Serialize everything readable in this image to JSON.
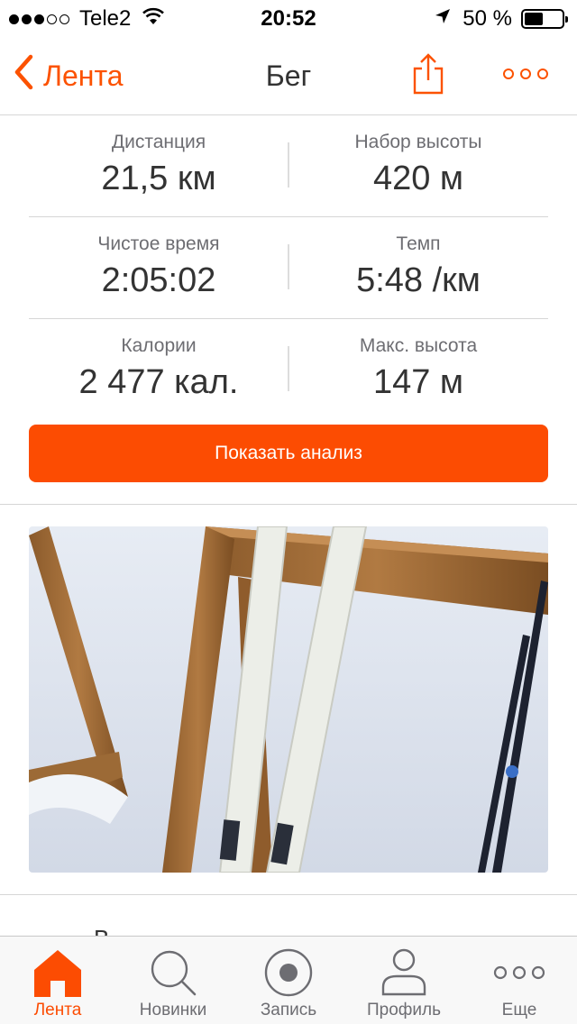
{
  "status_bar": {
    "carrier": "Tele2",
    "time": "20:52",
    "battery": "50 %",
    "signal_bars_filled": 3,
    "signal_bars_total": 5,
    "battery_level": 0.5
  },
  "nav": {
    "back_label": "Лента",
    "title": "Бег"
  },
  "stats": [
    {
      "left": {
        "label": "Дистанция",
        "value": "21,5 км"
      },
      "right": {
        "label": "Набор высоты",
        "value": "420 м"
      }
    },
    {
      "left": {
        "label": "Чистое время",
        "value": "2:05:02"
      },
      "right": {
        "label": "Темп",
        "value": "5:48 /км"
      }
    },
    {
      "left": {
        "label": "Калории",
        "value": "2 477 кал."
      },
      "right": {
        "label": "Макс. высота",
        "value": "147 м"
      }
    }
  ],
  "analysis_button": "Показать анализ",
  "partial_text": "В",
  "tabs": [
    {
      "label": "Лента",
      "icon": "home-icon",
      "active": true
    },
    {
      "label": "Новинки",
      "icon": "search-icon",
      "active": false
    },
    {
      "label": "Запись",
      "icon": "record-icon",
      "active": false
    },
    {
      "label": "Профиль",
      "icon": "profile-icon",
      "active": false
    },
    {
      "label": "Еще",
      "icon": "more-icon",
      "active": false
    }
  ],
  "colors": {
    "accent": "#fc4c02",
    "text": "#333333",
    "muted": "#6d6d72",
    "divider": "#d6d6d6"
  }
}
